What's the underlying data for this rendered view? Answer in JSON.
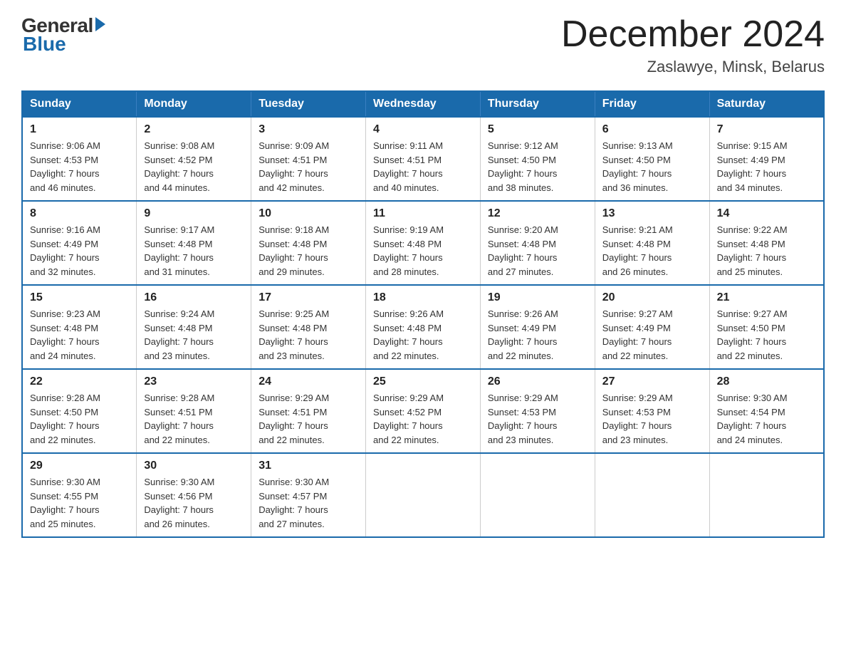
{
  "logo": {
    "general": "General",
    "blue": "Blue"
  },
  "title": "December 2024",
  "location": "Zaslawye, Minsk, Belarus",
  "days_of_week": [
    "Sunday",
    "Monday",
    "Tuesday",
    "Wednesday",
    "Thursday",
    "Friday",
    "Saturday"
  ],
  "weeks": [
    [
      {
        "day": "1",
        "sunrise": "9:06 AM",
        "sunset": "4:53 PM",
        "daylight": "7 hours and 46 minutes."
      },
      {
        "day": "2",
        "sunrise": "9:08 AM",
        "sunset": "4:52 PM",
        "daylight": "7 hours and 44 minutes."
      },
      {
        "day": "3",
        "sunrise": "9:09 AM",
        "sunset": "4:51 PM",
        "daylight": "7 hours and 42 minutes."
      },
      {
        "day": "4",
        "sunrise": "9:11 AM",
        "sunset": "4:51 PM",
        "daylight": "7 hours and 40 minutes."
      },
      {
        "day": "5",
        "sunrise": "9:12 AM",
        "sunset": "4:50 PM",
        "daylight": "7 hours and 38 minutes."
      },
      {
        "day": "6",
        "sunrise": "9:13 AM",
        "sunset": "4:50 PM",
        "daylight": "7 hours and 36 minutes."
      },
      {
        "day": "7",
        "sunrise": "9:15 AM",
        "sunset": "4:49 PM",
        "daylight": "7 hours and 34 minutes."
      }
    ],
    [
      {
        "day": "8",
        "sunrise": "9:16 AM",
        "sunset": "4:49 PM",
        "daylight": "7 hours and 32 minutes."
      },
      {
        "day": "9",
        "sunrise": "9:17 AM",
        "sunset": "4:48 PM",
        "daylight": "7 hours and 31 minutes."
      },
      {
        "day": "10",
        "sunrise": "9:18 AM",
        "sunset": "4:48 PM",
        "daylight": "7 hours and 29 minutes."
      },
      {
        "day": "11",
        "sunrise": "9:19 AM",
        "sunset": "4:48 PM",
        "daylight": "7 hours and 28 minutes."
      },
      {
        "day": "12",
        "sunrise": "9:20 AM",
        "sunset": "4:48 PM",
        "daylight": "7 hours and 27 minutes."
      },
      {
        "day": "13",
        "sunrise": "9:21 AM",
        "sunset": "4:48 PM",
        "daylight": "7 hours and 26 minutes."
      },
      {
        "day": "14",
        "sunrise": "9:22 AM",
        "sunset": "4:48 PM",
        "daylight": "7 hours and 25 minutes."
      }
    ],
    [
      {
        "day": "15",
        "sunrise": "9:23 AM",
        "sunset": "4:48 PM",
        "daylight": "7 hours and 24 minutes."
      },
      {
        "day": "16",
        "sunrise": "9:24 AM",
        "sunset": "4:48 PM",
        "daylight": "7 hours and 23 minutes."
      },
      {
        "day": "17",
        "sunrise": "9:25 AM",
        "sunset": "4:48 PM",
        "daylight": "7 hours and 23 minutes."
      },
      {
        "day": "18",
        "sunrise": "9:26 AM",
        "sunset": "4:48 PM",
        "daylight": "7 hours and 22 minutes."
      },
      {
        "day": "19",
        "sunrise": "9:26 AM",
        "sunset": "4:49 PM",
        "daylight": "7 hours and 22 minutes."
      },
      {
        "day": "20",
        "sunrise": "9:27 AM",
        "sunset": "4:49 PM",
        "daylight": "7 hours and 22 minutes."
      },
      {
        "day": "21",
        "sunrise": "9:27 AM",
        "sunset": "4:50 PM",
        "daylight": "7 hours and 22 minutes."
      }
    ],
    [
      {
        "day": "22",
        "sunrise": "9:28 AM",
        "sunset": "4:50 PM",
        "daylight": "7 hours and 22 minutes."
      },
      {
        "day": "23",
        "sunrise": "9:28 AM",
        "sunset": "4:51 PM",
        "daylight": "7 hours and 22 minutes."
      },
      {
        "day": "24",
        "sunrise": "9:29 AM",
        "sunset": "4:51 PM",
        "daylight": "7 hours and 22 minutes."
      },
      {
        "day": "25",
        "sunrise": "9:29 AM",
        "sunset": "4:52 PM",
        "daylight": "7 hours and 22 minutes."
      },
      {
        "day": "26",
        "sunrise": "9:29 AM",
        "sunset": "4:53 PM",
        "daylight": "7 hours and 23 minutes."
      },
      {
        "day": "27",
        "sunrise": "9:29 AM",
        "sunset": "4:53 PM",
        "daylight": "7 hours and 23 minutes."
      },
      {
        "day": "28",
        "sunrise": "9:30 AM",
        "sunset": "4:54 PM",
        "daylight": "7 hours and 24 minutes."
      }
    ],
    [
      {
        "day": "29",
        "sunrise": "9:30 AM",
        "sunset": "4:55 PM",
        "daylight": "7 hours and 25 minutes."
      },
      {
        "day": "30",
        "sunrise": "9:30 AM",
        "sunset": "4:56 PM",
        "daylight": "7 hours and 26 minutes."
      },
      {
        "day": "31",
        "sunrise": "9:30 AM",
        "sunset": "4:57 PM",
        "daylight": "7 hours and 27 minutes."
      },
      null,
      null,
      null,
      null
    ]
  ],
  "labels": {
    "sunrise": "Sunrise:",
    "sunset": "Sunset:",
    "daylight": "Daylight:"
  }
}
